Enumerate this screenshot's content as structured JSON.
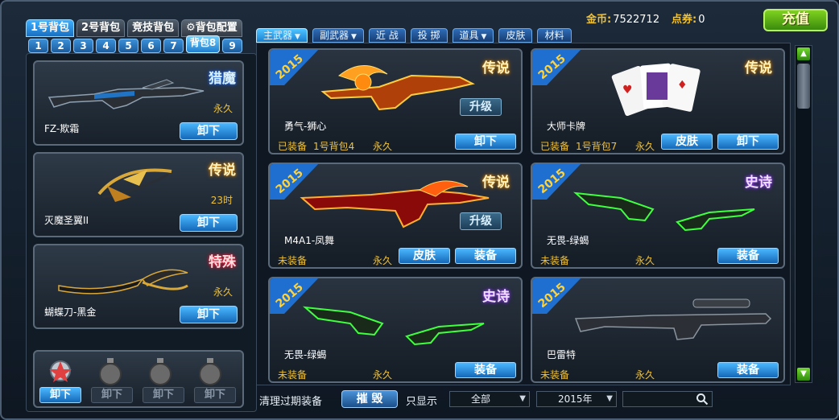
{
  "currency": {
    "coin_label": "金币:",
    "coin_value": "7522712",
    "coupon_label": "点券:",
    "coupon_value": "0"
  },
  "recharge_label": "充值",
  "bag_tabs": [
    "1号背包",
    "2号背包",
    "竞技背包",
    "背包配置"
  ],
  "number_tabs": [
    "1",
    "2",
    "3",
    "4",
    "5",
    "6",
    "7",
    "背包8",
    "9"
  ],
  "left_slots": [
    {
      "name": "FZ-欺霜",
      "rarity": "猎魔",
      "duration": "永久",
      "button": "卸下"
    },
    {
      "name": "灭魔圣翼II",
      "rarity": "传说",
      "duration": "23时",
      "button": "卸下"
    },
    {
      "name": "蝴蝶刀-黑金",
      "rarity": "特殊",
      "duration": "永久",
      "button": "卸下"
    }
  ],
  "grenade_buttons": [
    "卸下",
    "卸下",
    "卸下",
    "卸下"
  ],
  "category_tabs": [
    {
      "label": "主武器",
      "dropdown": true
    },
    {
      "label": "副武器",
      "dropdown": true
    },
    {
      "label": "近 战",
      "dropdown": false
    },
    {
      "label": "投 掷",
      "dropdown": false
    },
    {
      "label": "道具",
      "dropdown": true
    },
    {
      "label": "皮肤",
      "dropdown": false
    },
    {
      "label": "材料",
      "dropdown": false
    }
  ],
  "items": [
    {
      "ribbon": "2015",
      "name": "勇气-狮心",
      "rarity": "传说",
      "status": "已装备",
      "bag": "1号背包4",
      "duration": "永久",
      "upgrade": "升级",
      "btn1": "卸下",
      "btn2": ""
    },
    {
      "ribbon": "2015",
      "name": "大师卡牌",
      "rarity": "传说",
      "status": "已装备",
      "bag": "1号背包7",
      "duration": "永久",
      "upgrade": "",
      "btn1": "卸下",
      "btn2": "皮肤"
    },
    {
      "ribbon": "2015",
      "name": "M4A1-凤舞",
      "rarity": "传说",
      "status": "未装备",
      "bag": "",
      "duration": "永久",
      "upgrade": "升级",
      "btn1": "装备",
      "btn2": "皮肤"
    },
    {
      "ribbon": "2015",
      "name": "无畏-绿蝎",
      "rarity": "史诗",
      "status": "未装备",
      "bag": "",
      "duration": "永久",
      "upgrade": "",
      "btn1": "装备",
      "btn2": ""
    },
    {
      "ribbon": "2015",
      "name": "无畏-绿蝎",
      "rarity": "史诗",
      "status": "未装备",
      "bag": "",
      "duration": "永久",
      "upgrade": "",
      "btn1": "装备",
      "btn2": ""
    },
    {
      "ribbon": "2015",
      "name": "巴雷特",
      "rarity": "",
      "status": "未装备",
      "bag": "",
      "duration": "永久",
      "upgrade": "",
      "btn1": "装备",
      "btn2": ""
    }
  ],
  "bottom": {
    "clean_label": "清理过期装备",
    "destroy_label": "摧 毁",
    "show_label": "只显示",
    "filter_value": "全部",
    "year_value": "2015年",
    "search_placeholder": ""
  },
  "colors": {
    "accent_blue": "#1a80d0",
    "gold": "#f0c23a",
    "recharge_green": "#3a8a0c"
  }
}
